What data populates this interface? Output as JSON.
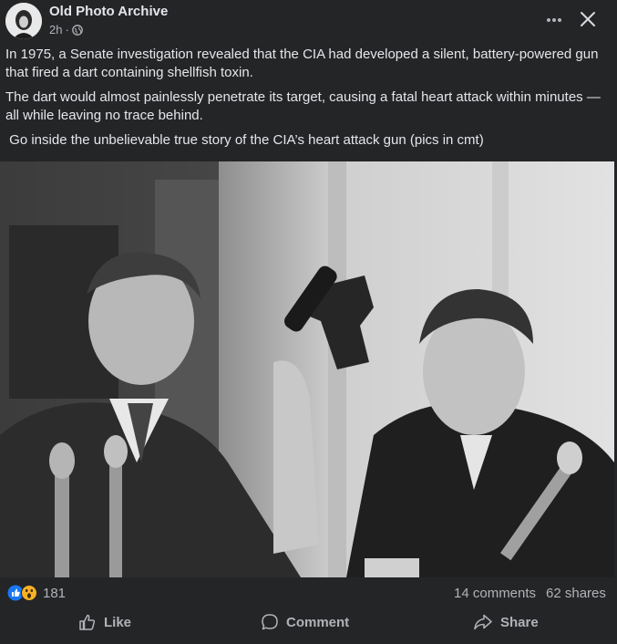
{
  "header": {
    "page_name": "Old Photo Archive",
    "time": "2h",
    "separator": "·"
  },
  "post": {
    "paragraphs": [
      "In 1975, a Senate investigation revealed that the CIA had developed a silent, battery-powered gun that fired a dart containing shellfish toxin.",
      "The dart would almost painlessly penetrate its target, causing a fatal heart attack within minutes — all while leaving no trace behind.",
      " Go inside the unbelievable true story of the CIA’s heart attack gun (pics in cmt)"
    ]
  },
  "stats": {
    "reaction_count": "181",
    "comments": "14 comments",
    "shares": "62 shares"
  },
  "actions": {
    "like": "Like",
    "comment": "Comment",
    "share": "Share"
  },
  "colors": {
    "background": "#242526",
    "text": "#e4e6eb",
    "secondary": "#b0b3b8",
    "like_blue": "#1877f2",
    "wow_yellow": "#f7b125"
  },
  "icons": [
    "globe-icon",
    "more-icon",
    "close-icon",
    "like-reaction-icon",
    "wow-reaction-icon",
    "like-icon",
    "comment-icon",
    "share-icon"
  ]
}
